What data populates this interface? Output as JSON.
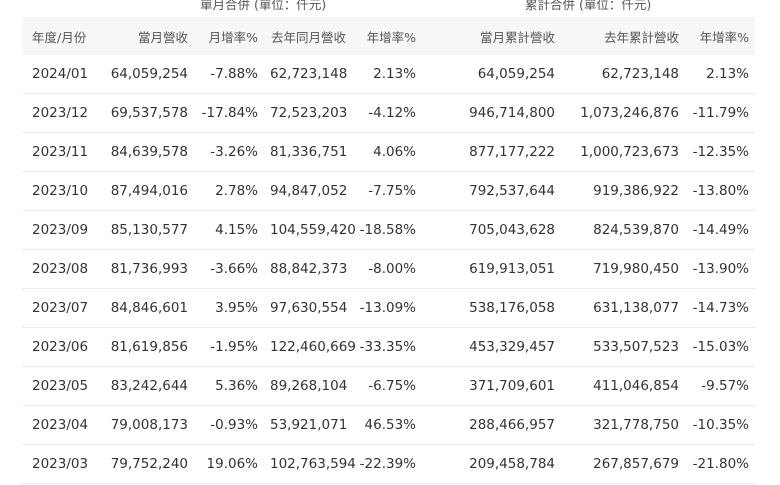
{
  "groups": {
    "monthly": "單月合併 (單位：仟元)",
    "cumulative": "累計合併 (單位：仟元)"
  },
  "headers": [
    "年度/月份",
    "當月營收",
    "月增率%",
    "去年同月營收",
    "年增率%",
    "當月累計營收",
    "去年累計營收",
    "年增率%"
  ],
  "rows": [
    [
      "2024/01",
      "64,059,254",
      "-7.88%",
      "62,723,148",
      "2.13%",
      "64,059,254",
      "62,723,148",
      "2.13%"
    ],
    [
      "2023/12",
      "69,537,578",
      "-17.84%",
      "72,523,203",
      "-4.12%",
      "946,714,800",
      "1,073,246,876",
      "-11.79%"
    ],
    [
      "2023/11",
      "84,639,578",
      "-3.26%",
      "81,336,751",
      "4.06%",
      "877,177,222",
      "1,000,723,673",
      "-12.35%"
    ],
    [
      "2023/10",
      "87,494,016",
      "2.78%",
      "94,847,052",
      "-7.75%",
      "792,537,644",
      "919,386,922",
      "-13.80%"
    ],
    [
      "2023/09",
      "85,130,577",
      "4.15%",
      "104,559,420",
      "-18.58%",
      "705,043,628",
      "824,539,870",
      "-14.49%"
    ],
    [
      "2023/08",
      "81,736,993",
      "-3.66%",
      "88,842,373",
      "-8.00%",
      "619,913,051",
      "719,980,450",
      "-13.90%"
    ],
    [
      "2023/07",
      "84,846,601",
      "3.95%",
      "97,630,554",
      "-13.09%",
      "538,176,058",
      "631,138,077",
      "-14.73%"
    ],
    [
      "2023/06",
      "81,619,856",
      "-1.95%",
      "122,460,669",
      "-33.35%",
      "453,329,457",
      "533,507,523",
      "-15.03%"
    ],
    [
      "2023/05",
      "83,242,644",
      "5.36%",
      "89,268,104",
      "-6.75%",
      "371,709,601",
      "411,046,854",
      "-9.57%"
    ],
    [
      "2023/04",
      "79,008,173",
      "-0.93%",
      "53,921,071",
      "46.53%",
      "288,466,957",
      "321,778,750",
      "-10.35%"
    ],
    [
      "2023/03",
      "79,752,240",
      "19.06%",
      "102,763,594",
      "-22.39%",
      "209,458,784",
      "267,857,679",
      "-21.80%"
    ]
  ]
}
